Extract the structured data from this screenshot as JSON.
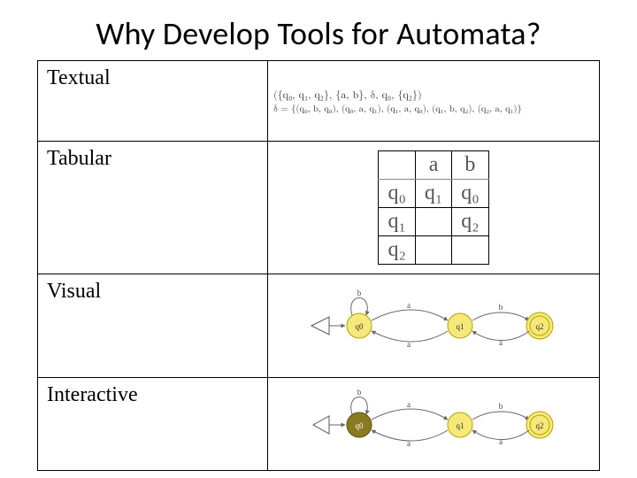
{
  "title": "Why Develop Tools for Automata?",
  "rows": {
    "textual": {
      "label": "Textual",
      "line1": "({q₀, q₁, q₂}, {a, b}, δ, q₀, {q₂})",
      "line2": "δ = {(q₀, b, q₀), (q₀, a, q₁), (q₁, a, q₀), (q₁, b, q₂), (q₂, a, q₁)}"
    },
    "tabular": {
      "label": "Tabular",
      "headers": {
        "c1": "a",
        "c2": "b"
      },
      "r0": {
        "s": "q₀",
        "a": "q₁",
        "b": "q₀"
      },
      "r1": {
        "s": "q₁",
        "a": "",
        "b": "q₂"
      },
      "r2": {
        "s": "q₂",
        "a": "",
        "b": ""
      }
    },
    "visual": {
      "label": "Visual",
      "states": {
        "q0": "q0",
        "q1": "q1",
        "q2": "q2"
      },
      "sym": {
        "a": "a",
        "b": "b"
      }
    },
    "interactive": {
      "label": "Interactive",
      "states": {
        "q0": "q0",
        "q1": "q1",
        "q2": "q2"
      },
      "sym": {
        "a": "a",
        "b": "b"
      }
    }
  }
}
